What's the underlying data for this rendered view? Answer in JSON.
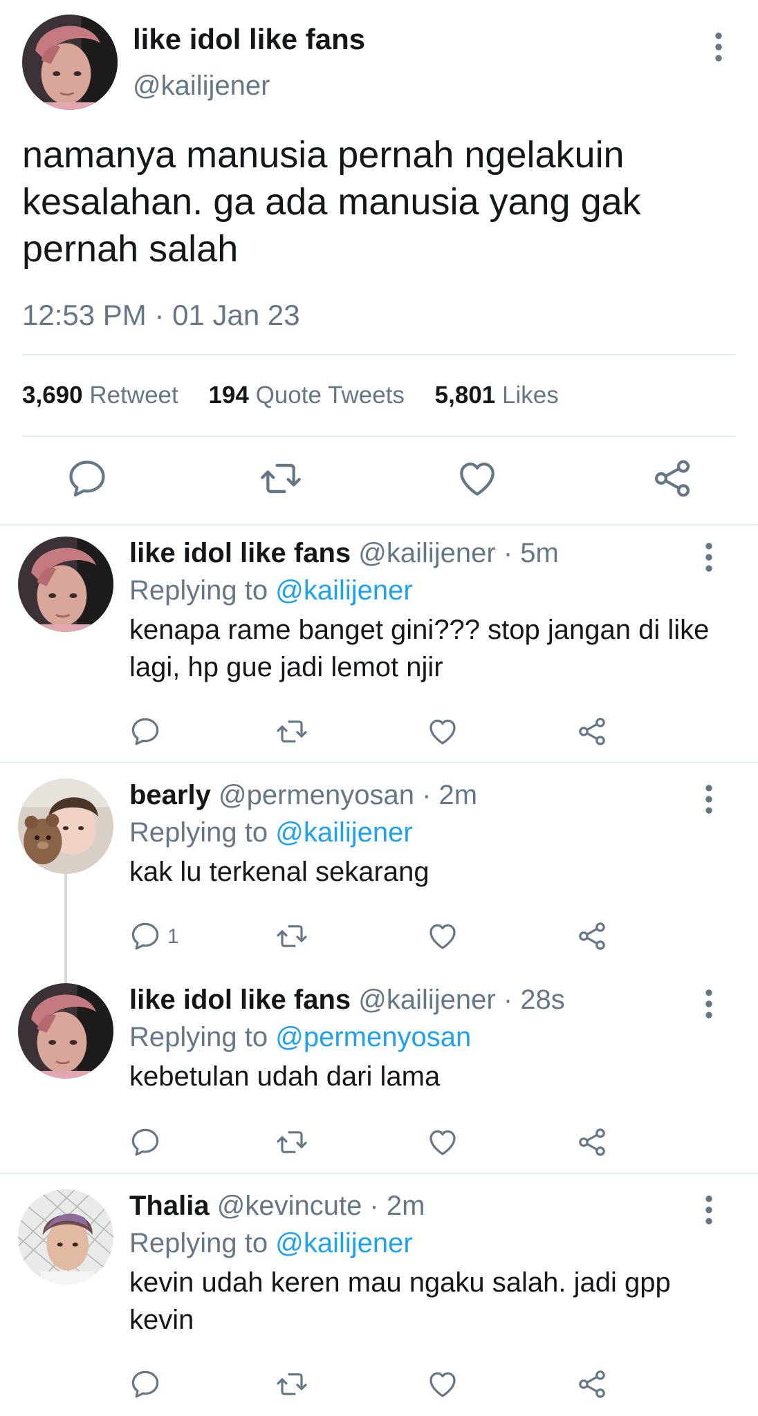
{
  "main_tweet": {
    "name": "like idol like fans",
    "handle": "@kailijener",
    "text": "namanya manusia pernah ngelakuin kesalahan. ga ada manusia yang gak pernah salah",
    "timestamp": "12:53 PM · 01 Jan 23",
    "stats": {
      "retweets_count": "3,690",
      "retweets_label": "Retweet",
      "quotes_count": "194",
      "quotes_label": "Quote Tweets",
      "likes_count": "5,801",
      "likes_label": "Likes"
    }
  },
  "replies": [
    {
      "name": "like idol like fans",
      "handle_time": "@kailijener · 5m",
      "replying_prefix": "Replying to",
      "replying_to": "@kailijener",
      "text": "kenapa rame banget gini??? stop jangan di like lagi, hp gue jadi lemot njir",
      "reply_count": ""
    },
    {
      "name": "bearly",
      "handle_time": "@permenyosan · 2m",
      "replying_prefix": "Replying to",
      "replying_to": "@kailijener",
      "text": "kak lu terkenal sekarang",
      "reply_count": "1"
    },
    {
      "name": "like idol like fans",
      "handle_time": "@kailijener · 28s",
      "replying_prefix": "Replying to",
      "replying_to": "@permenyosan",
      "text": "kebetulan udah dari lama",
      "reply_count": ""
    },
    {
      "name": "Thalia",
      "handle_time": "@kevincute · 2m",
      "replying_prefix": "Replying to",
      "replying_to": "@kailijener",
      "text": "kevin udah keren mau ngaku salah. jadi gpp kevin",
      "reply_count": ""
    }
  ],
  "icons": {
    "reply": "speech-bubble-icon",
    "retweet": "retweet-icon",
    "like": "heart-icon",
    "share": "share-icon",
    "more": "vertical-ellipsis-icon"
  },
  "colors": {
    "text": "#14171a",
    "secondary": "#657786",
    "link": "#1da1f2",
    "divider": "#e6ecf0"
  }
}
